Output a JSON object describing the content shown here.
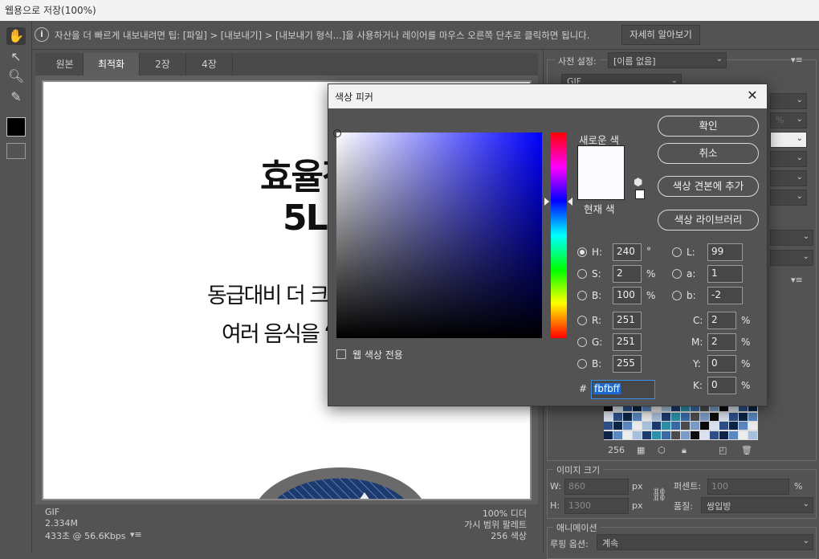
{
  "window": {
    "title": "웹용으로 저장(100%)"
  },
  "tip": {
    "text": "자산을 더 빠르게 내보내려면 팁: [파일] > [내보내기] > [내보내기 형식...]을 사용하거나 레이어를 마우스 오른쪽 단추로 클릭하면 됩니다.",
    "more_button": "자세히 알아보기"
  },
  "tools": [
    "hand-tool",
    "slice-select-tool",
    "zoom-tool",
    "eyedropper-tool"
  ],
  "tabs": [
    {
      "label": "원본",
      "active": false
    },
    {
      "label": "최적화",
      "active": true
    },
    {
      "label": "2장",
      "active": false
    },
    {
      "label": "4장",
      "active": false
    }
  ],
  "canvas": {
    "headline1": "효율적",
    "headline2": "5L",
    "body1": "동급대비 더 크",
    "body2": "여러 음식을 ‘"
  },
  "status": {
    "format": "GIF",
    "size": "2.334M",
    "time": "433초 @ 56.6Kbps",
    "zoom": "100% 디더",
    "palette": "가시 범위 팔레트",
    "colors": "256 색상"
  },
  "right_panel": {
    "preset_label": "사전 설정:",
    "preset_value": "[이름 없음]",
    "format_value": "GIF",
    "color_count": "256",
    "image_size_label": "이미지 크기",
    "width_label": "W:",
    "width_value": "860",
    "height_label": "H:",
    "height_value": "1300",
    "px": "px",
    "percent_label": "퍼센트:",
    "percent_value": "100",
    "percent_unit": "%",
    "quality_label": "품질:",
    "quality_value": "쌍입방",
    "animation_label": "애니메이션",
    "loop_label": "루핑 옵션:",
    "loop_value": "계속"
  },
  "color_picker": {
    "title": "색상 피커",
    "new_color_label": "새로운 색",
    "current_color_label": "현재 색",
    "ok": "확인",
    "cancel": "취소",
    "add_swatch": "색상 견본에 추가",
    "libraries": "색상 라이브러리",
    "web_only": "웹 색상 전용",
    "hsb": {
      "H": "240",
      "S": "2",
      "B": "100"
    },
    "rgb": {
      "R": "251",
      "G": "251",
      "B": "255"
    },
    "lab": {
      "L": "99",
      "a": "1",
      "b": "-2"
    },
    "cmyk": {
      "C": "2",
      "M": "2",
      "Y": "0",
      "K": "0"
    },
    "hex": "fbfbff",
    "degree": "°",
    "percent": "%",
    "hash": "#",
    "selected_color": "#fbfbff"
  },
  "colors": {
    "bg": "#535353",
    "dialog_title_bg": "#f2f2f2",
    "accent": "#1e6ad0",
    "palette_navy": "#1c3a6e"
  }
}
